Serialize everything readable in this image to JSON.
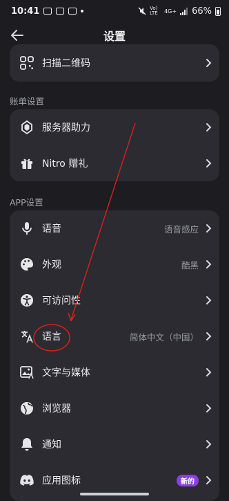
{
  "status": {
    "time": "10:41",
    "carrier": "Vo) LTE",
    "network": "4G+",
    "battery": "66%"
  },
  "header": {
    "title": "设置"
  },
  "top_item": {
    "label": "扫描二维码"
  },
  "account": {
    "section_title": "账单设置",
    "items": [
      {
        "label": "服务器助力"
      },
      {
        "label": "Nitro 赠礼"
      }
    ]
  },
  "app": {
    "section_title": "APP设置",
    "items": [
      {
        "label": "语音",
        "value": "语音感应"
      },
      {
        "label": "外观",
        "value": "酷黑"
      },
      {
        "label": "可访问性",
        "value": ""
      },
      {
        "label": "语言",
        "value": "简体中文（中国）"
      },
      {
        "label": "文字与媒体",
        "value": ""
      },
      {
        "label": "浏览器",
        "value": ""
      },
      {
        "label": "通知",
        "value": ""
      },
      {
        "label": "应用图标",
        "badge": "新的"
      }
    ]
  },
  "colors": {
    "background": "#1c1c21",
    "card": "#2b2b31",
    "annotation": "#d6231b",
    "badge": "#8c3fe0"
  }
}
